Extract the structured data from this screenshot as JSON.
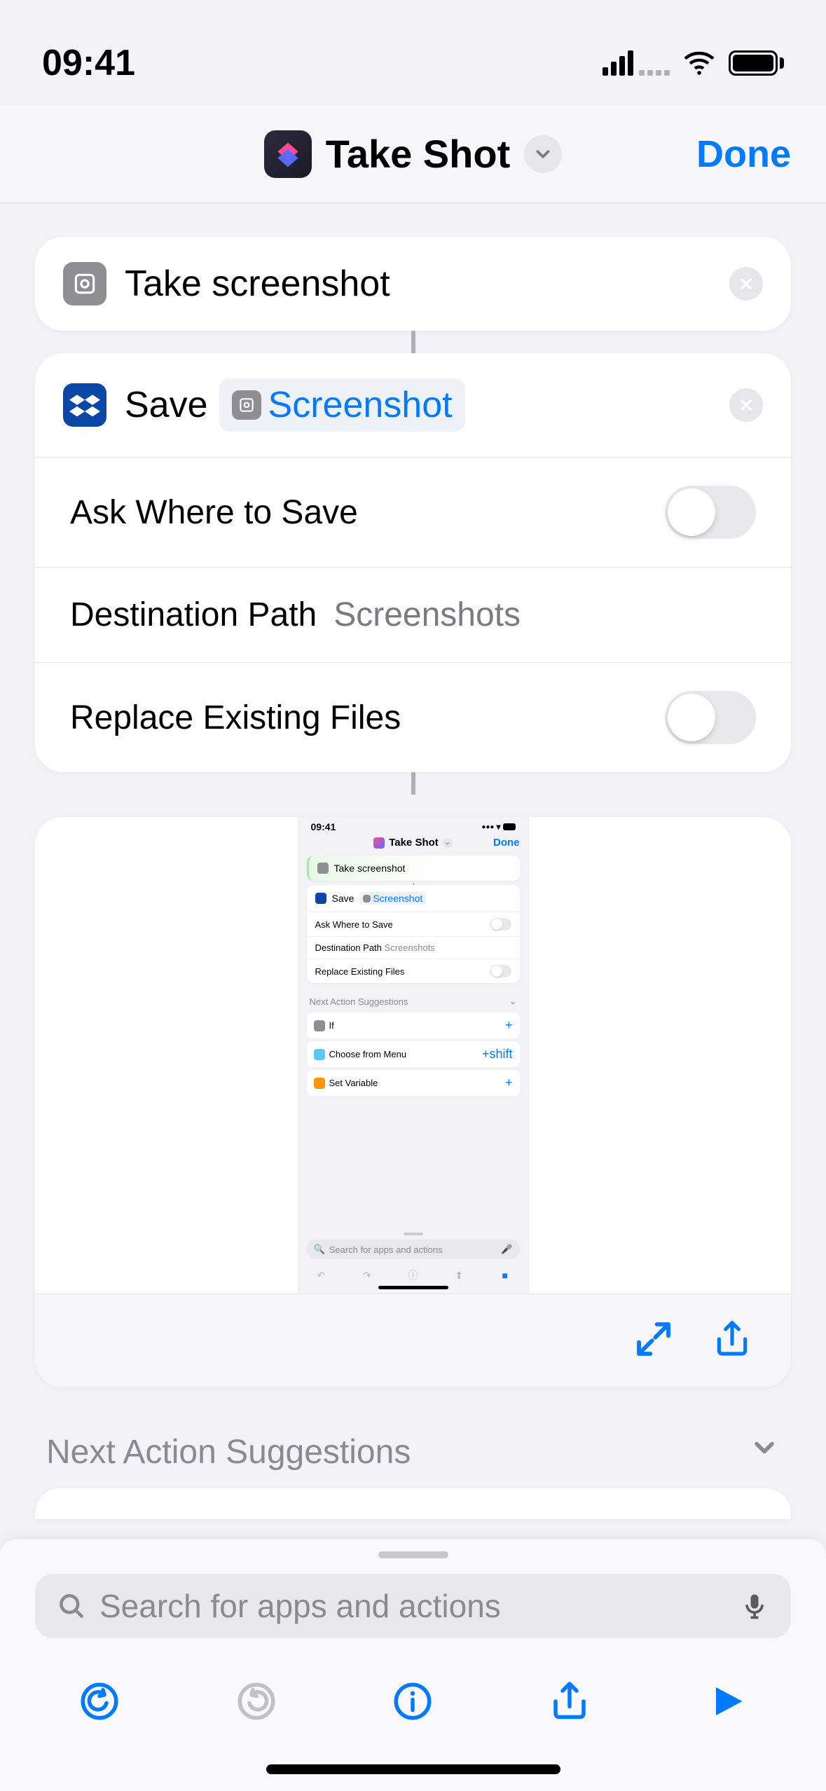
{
  "status": {
    "time": "09:41"
  },
  "nav": {
    "title": "Take Shot",
    "done": "Done"
  },
  "actions": {
    "take_screenshot": {
      "label": "Take screenshot"
    },
    "save": {
      "label": "Save",
      "token": "Screenshot",
      "options": {
        "ask_where": {
          "label": "Ask Where to Save",
          "enabled": false
        },
        "dest_path": {
          "label": "Destination Path",
          "value": "Screenshots"
        },
        "replace": {
          "label": "Replace Existing Files",
          "enabled": false
        }
      }
    }
  },
  "preview": {
    "status_time": "09:41",
    "title": "Take Shot",
    "done": "Done",
    "row1": "Take screenshot",
    "row2_a": "Save",
    "row2_b": "Screenshot",
    "opt1": "Ask Where to Save",
    "opt2a": "Destination Path",
    "opt2b": "Screenshots",
    "opt3": "Replace Existing Files",
    "sugg_header": "Next Action Suggestions",
    "sugg1": "If",
    "sugg2": "Choose from Menu",
    "sugg3": "Set Variable",
    "search": "Search for apps and actions"
  },
  "suggestions": {
    "header": "Next Action Suggestions"
  },
  "search": {
    "placeholder": "Search for apps and actions"
  }
}
